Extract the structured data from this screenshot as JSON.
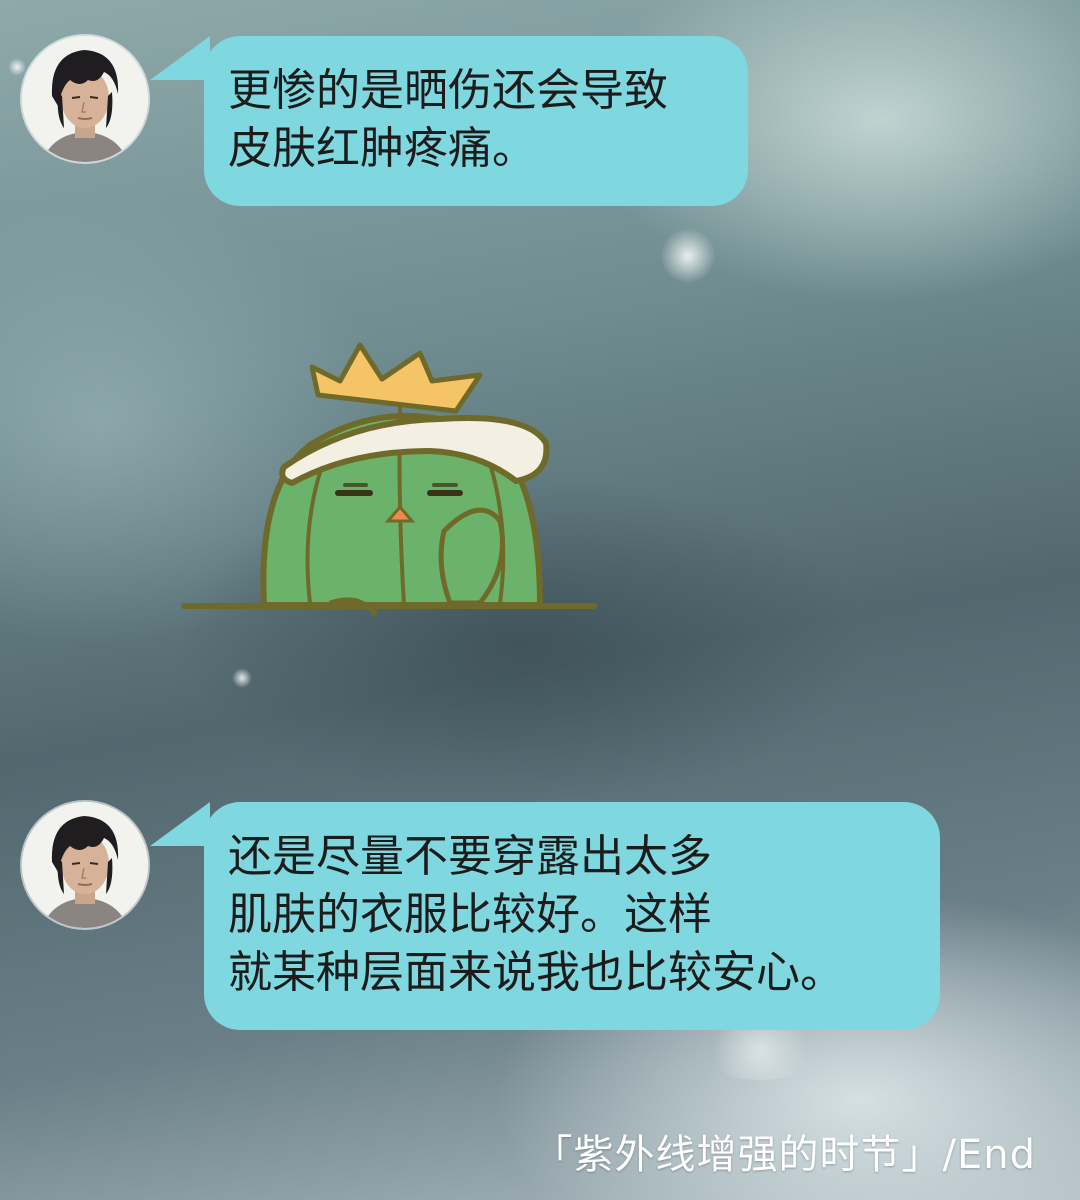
{
  "messages": [
    {
      "sender": "avatar",
      "lines": [
        "更惨的是晒伤还会导致",
        "皮肤红肿疼痛。"
      ]
    },
    {
      "sender": "avatar",
      "lines": [
        "还是尽量不要穿露出太多",
        "肌肤的衣服比较好。这样",
        "就某种层面来说我也比较安心。"
      ]
    }
  ],
  "sticker": {
    "icon": "cactus-mascot-sticker-icon"
  },
  "footer": {
    "caption": "「紫外线增强的时节」/End"
  },
  "colors": {
    "bubble": "#7fd7df",
    "bubble_text": "#1c1c1c",
    "caption": "#ffffff",
    "sticker_green": "#6bb36a",
    "sticker_crown": "#f4c466"
  }
}
